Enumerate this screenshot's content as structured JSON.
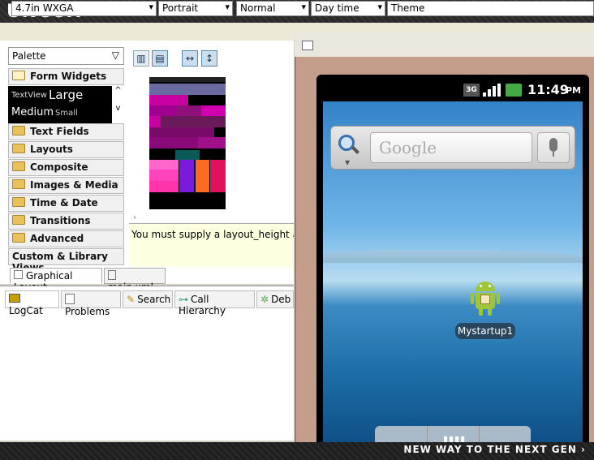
{
  "brand": {
    "logo": "UNCOX",
    "tagline": "NEW WAY TO THE NEXT GEN ›"
  },
  "config": {
    "device": "4.7in WXGA",
    "orientation": "Portrait",
    "ui_mode": "Normal",
    "night_mode": "Day time",
    "theme": "Theme"
  },
  "palette": {
    "title": "Palette",
    "categories": [
      {
        "label": "Form Widgets",
        "expanded": true
      },
      {
        "label": "Text Fields"
      },
      {
        "label": "Layouts"
      },
      {
        "label": "Composite"
      },
      {
        "label": "Images & Media"
      },
      {
        "label": "Time & Date"
      },
      {
        "label": "Transitions"
      },
      {
        "label": "Advanced"
      },
      {
        "label": "Custom & Library Views"
      }
    ],
    "widgets": {
      "textview": "TextView",
      "large": "Large",
      "medium": "Medium",
      "small": "Small"
    }
  },
  "editor": {
    "message": "You must supply a layout_height attrib",
    "tabs": [
      "Graphical Layout",
      "main.xml"
    ]
  },
  "bottom_tabs": [
    "LogCat",
    "Problems",
    "Search",
    "Call Hierarchy",
    "Deb"
  ],
  "emulator": {
    "clock": "11:49",
    "ampm": "PM",
    "network": "3G",
    "search_placeholder": "Google",
    "app_label": "Mystartup1"
  },
  "colors": {
    "accent_magenta": "#c800a0",
    "preview_purple": "#6a1a8a",
    "android_green": "#9fc63a"
  }
}
